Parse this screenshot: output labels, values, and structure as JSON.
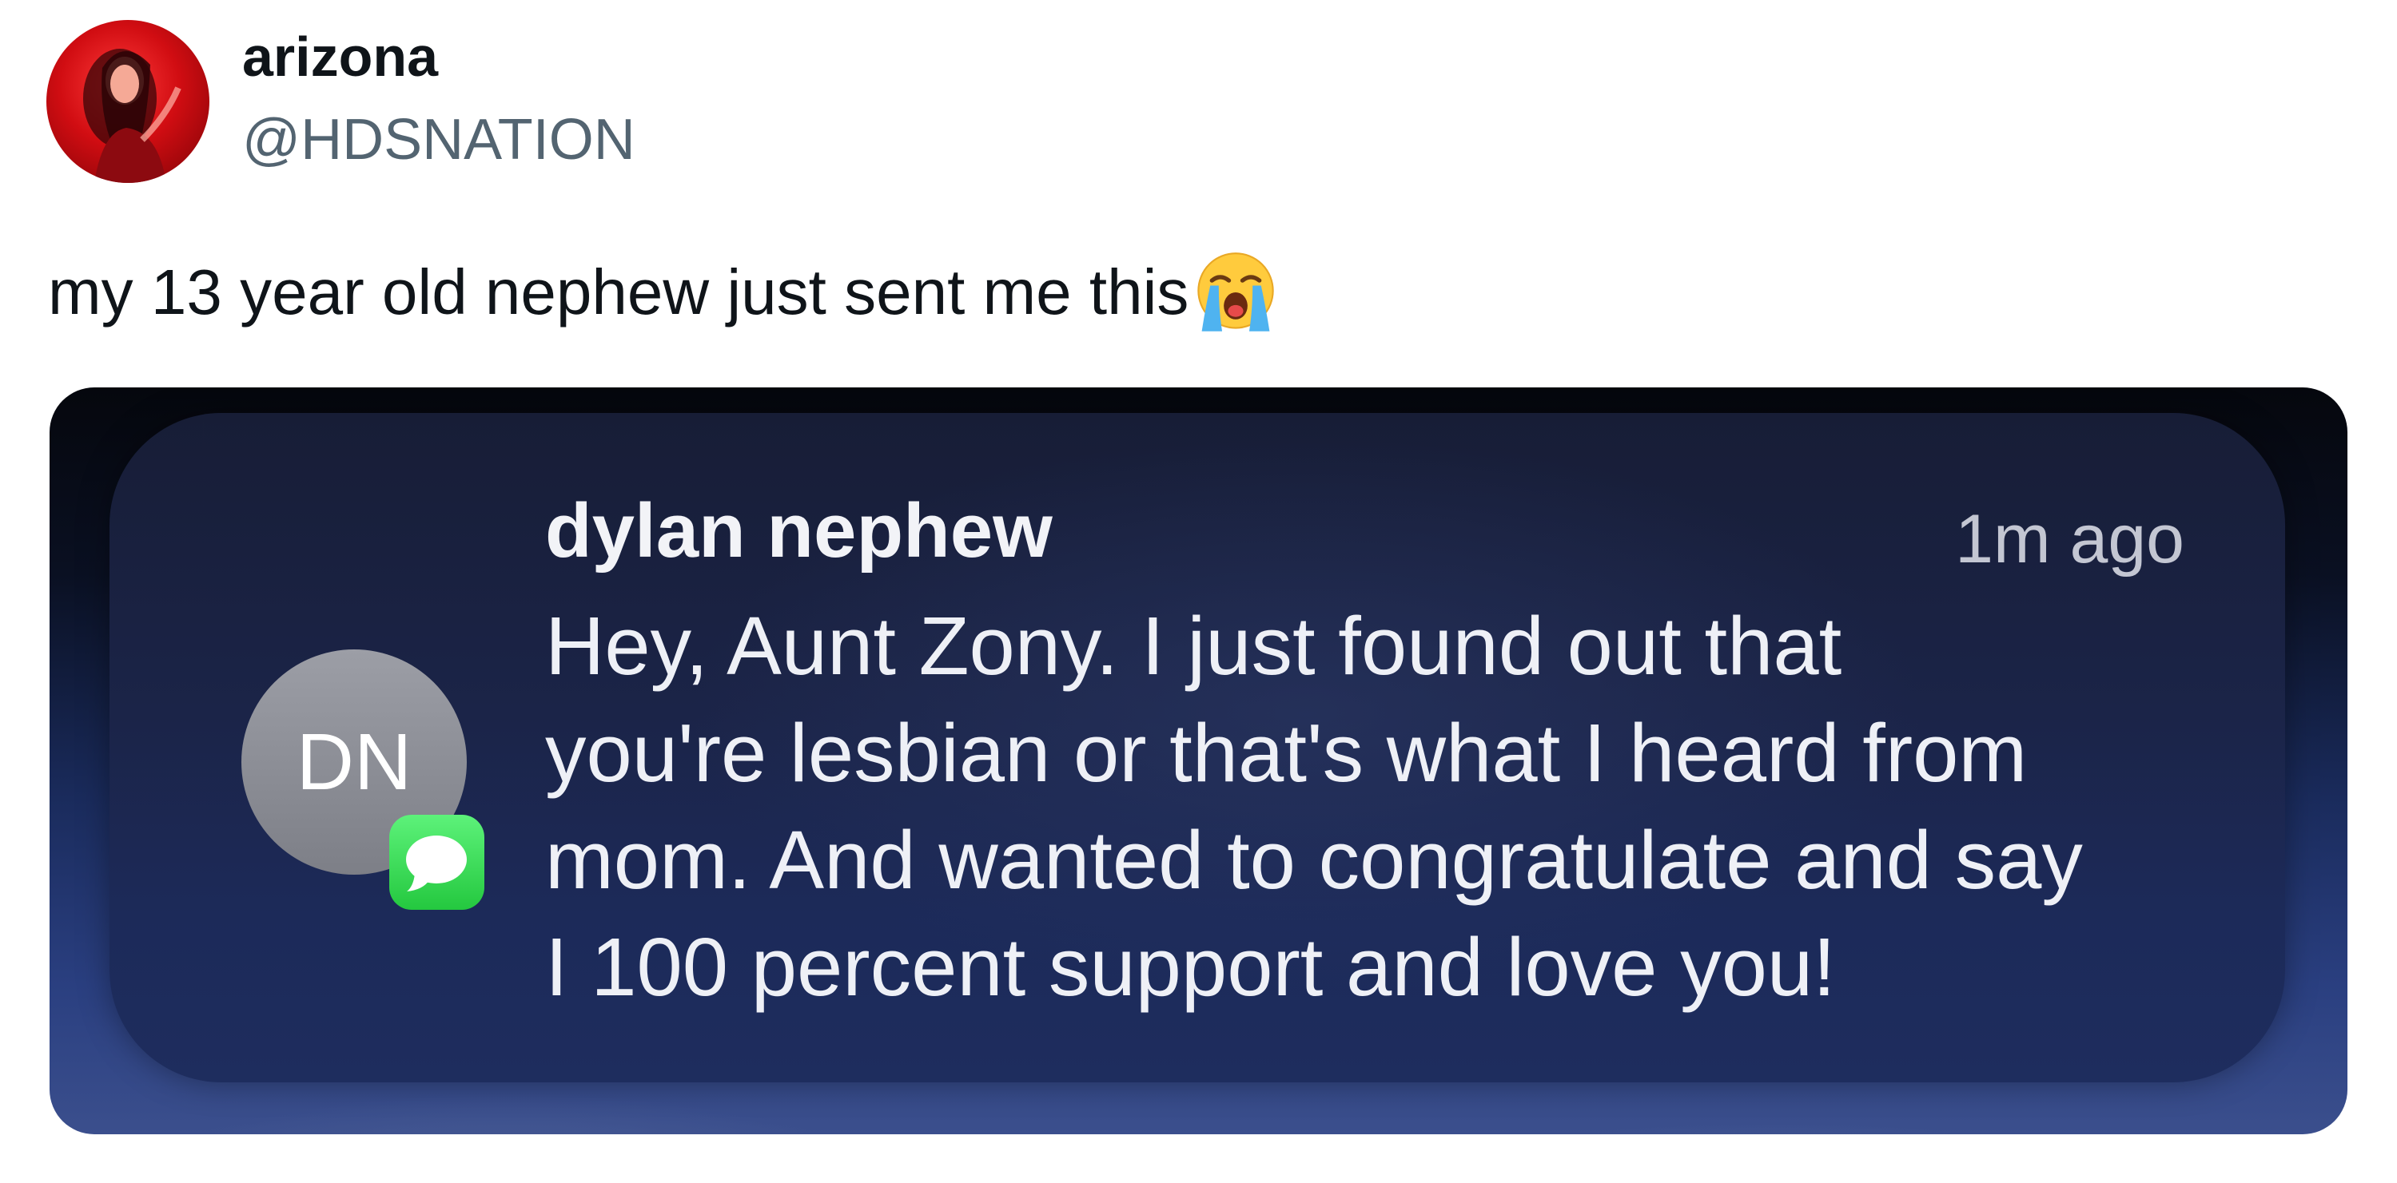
{
  "tweet": {
    "author": {
      "display_name": "arizona",
      "handle": "@HDSNATION",
      "avatar_icon": "profile-photo"
    },
    "text": "my 13 year old nephew just sent me this",
    "emoji_icon": "loudly-crying-face"
  },
  "notification": {
    "sender": "dylan nephew",
    "time": "1m ago",
    "initials": "DN",
    "app_badge_icon": "messages-app-icon",
    "message_lines": [
      "Hey, Aunt Zony. I just found out that",
      "you're lesbian or that's what I heard from",
      "mom. And wanted to congratulate and say",
      "I 100 percent support and love you!"
    ]
  },
  "colors": {
    "name_text": "#0f1419",
    "handle_text": "#536471",
    "notification_bg": "#1b2448",
    "messages_green": "#34d058",
    "avatar_red": "#d10d12"
  }
}
